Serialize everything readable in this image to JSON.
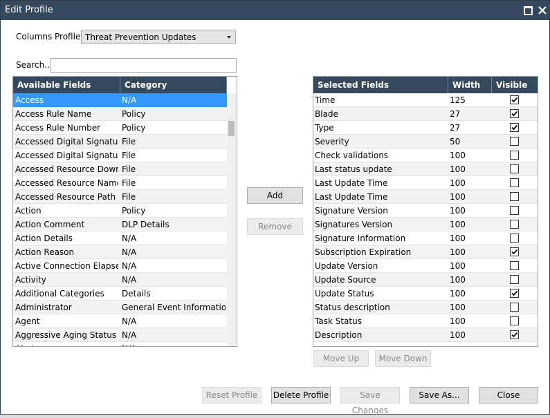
{
  "window": {
    "title": "Edit Profile"
  },
  "columns_profile": {
    "label": "Columns Profile:",
    "value": "Threat Prevention Updates"
  },
  "search": {
    "label": "Search...",
    "value": ""
  },
  "available": {
    "headers": [
      "Available Fields",
      "Category"
    ],
    "rows": [
      {
        "field": "Access",
        "category": "N/A"
      },
      {
        "field": "Access Rule Name",
        "category": "Policy"
      },
      {
        "field": "Access Rule Number",
        "category": "Policy"
      },
      {
        "field": "Accessed Digital Signature A",
        "category": "File"
      },
      {
        "field": "Accessed Digital Signature C",
        "category": "File"
      },
      {
        "field": "Accessed Resource Downloa",
        "category": "File"
      },
      {
        "field": "Accessed Resource Name",
        "category": "File"
      },
      {
        "field": "Accessed Resource Path",
        "category": "File"
      },
      {
        "field": "Action",
        "category": "Policy"
      },
      {
        "field": "Action Comment",
        "category": "DLP Details"
      },
      {
        "field": "Action Details",
        "category": "N/A"
      },
      {
        "field": "Action Reason",
        "category": "N/A"
      },
      {
        "field": "Active Connection Elapsed",
        "category": "N/A"
      },
      {
        "field": "Activity",
        "category": "N/A"
      },
      {
        "field": "Additional Categories",
        "category": "Details"
      },
      {
        "field": "Administrator",
        "category": "General Event Information"
      },
      {
        "field": "Agent",
        "category": "N/A"
      },
      {
        "field": "Aggressive Aging Status",
        "category": "N/A"
      },
      {
        "field": "Alert",
        "category": "N/A"
      }
    ]
  },
  "selected": {
    "headers": [
      "Selected Fields",
      "Width",
      "Visible"
    ],
    "rows": [
      {
        "field": "Time",
        "width": "125",
        "visible": true
      },
      {
        "field": "Blade",
        "width": "27",
        "visible": true
      },
      {
        "field": "Type",
        "width": "27",
        "visible": true
      },
      {
        "field": "Severity",
        "width": "50",
        "visible": false
      },
      {
        "field": "Check validations",
        "width": "100",
        "visible": false
      },
      {
        "field": "Last status update",
        "width": "100",
        "visible": false
      },
      {
        "field": "Last Update Time",
        "width": "100",
        "visible": false
      },
      {
        "field": "Last Update Time",
        "width": "100",
        "visible": false
      },
      {
        "field": "Signature Version",
        "width": "100",
        "visible": false
      },
      {
        "field": "Signatures Version",
        "width": "100",
        "visible": false
      },
      {
        "field": "Signature Information",
        "width": "100",
        "visible": false
      },
      {
        "field": "Subscription Expiration",
        "width": "100",
        "visible": true
      },
      {
        "field": "Update Version",
        "width": "100",
        "visible": false
      },
      {
        "field": "Update Source",
        "width": "100",
        "visible": false
      },
      {
        "field": "Update Status",
        "width": "100",
        "visible": true
      },
      {
        "field": "Status description",
        "width": "100",
        "visible": false
      },
      {
        "field": "Task Status",
        "width": "100",
        "visible": false
      },
      {
        "field": "Description",
        "width": "100",
        "visible": true
      }
    ]
  },
  "buttons": {
    "add": "Add",
    "remove": "Remove",
    "move_up": "Move Up",
    "move_down": "Move Down",
    "reset_profile": "Reset Profile",
    "delete_profile": "Delete Profile",
    "save_changes": "Save Changes",
    "save_as": "Save As...",
    "close": "Close"
  },
  "colors": {
    "header": "#34495e",
    "selection": "#3399ff",
    "titlebar": "#34495e"
  }
}
